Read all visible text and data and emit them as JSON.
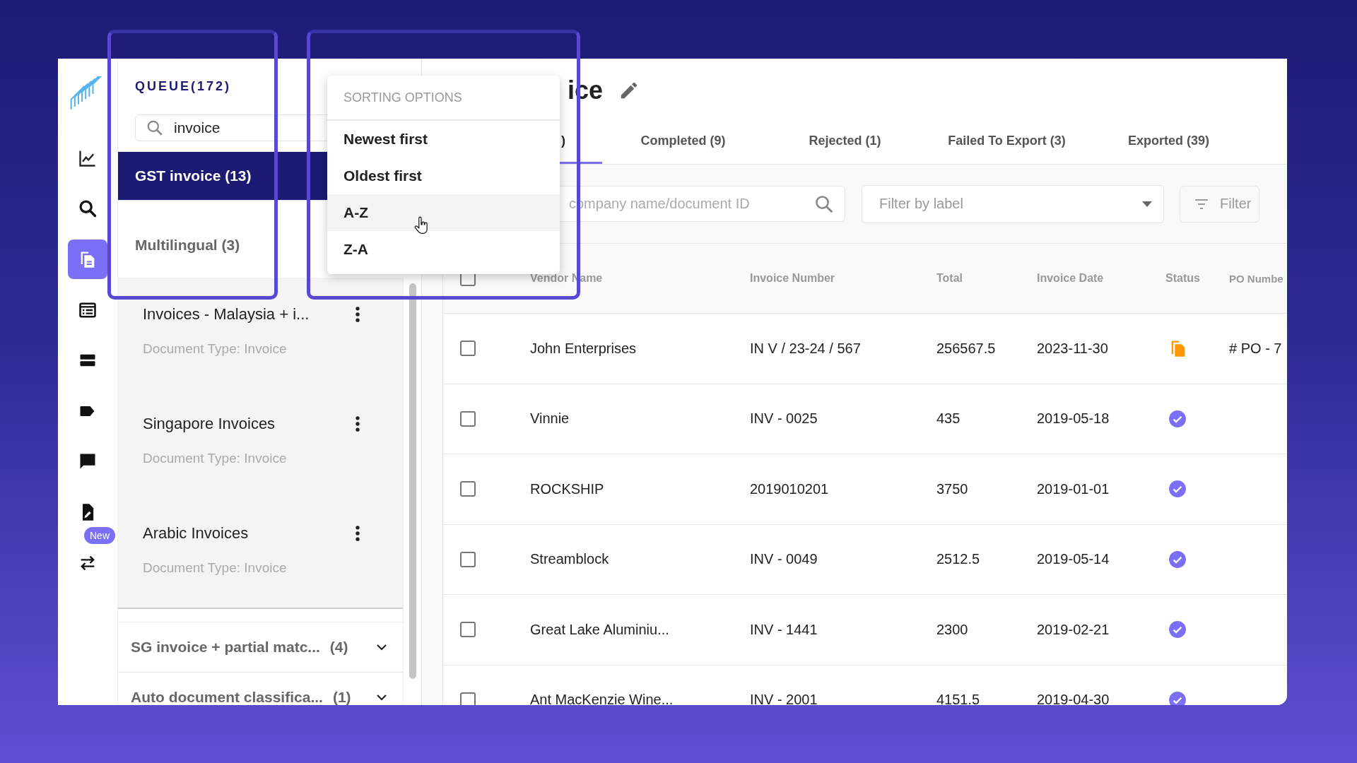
{
  "rail": {
    "items": [
      {
        "selected": false
      },
      {
        "selected": false
      },
      {
        "selected": true
      },
      {
        "selected": false
      },
      {
        "selected": false
      },
      {
        "selected": false
      },
      {
        "selected": false
      },
      {
        "selected": false
      },
      {
        "selected": false,
        "badge": "New"
      }
    ]
  },
  "queue": {
    "title": "QUEUE(172)",
    "search": {
      "value": "invoice"
    },
    "items": [
      {
        "label": "GST invoice (13)",
        "selected": true
      },
      {
        "label": "Multilingual (3)",
        "selected": false
      }
    ],
    "subqueues": [
      {
        "name": "Invoices - Malaysia + i...",
        "document_type": "Document Type: Invoice"
      },
      {
        "name": "Singapore Invoices",
        "document_type": "Document Type: Invoice"
      },
      {
        "name": "Arabic Invoices",
        "document_type": "Document Type: Invoice"
      }
    ],
    "groups": [
      {
        "name": "SG invoice + partial matc...",
        "count": "(4)"
      },
      {
        "name": "Auto document classifica...",
        "count": "(1)"
      }
    ]
  },
  "sort_menu": {
    "title": "SORTING OPTIONS",
    "options": [
      {
        "label": "Newest first",
        "hovered": false
      },
      {
        "label": "Oldest first",
        "hovered": false
      },
      {
        "label": "A-Z",
        "hovered": true
      },
      {
        "label": "Z-A",
        "hovered": false
      }
    ]
  },
  "header": {
    "title": "ice"
  },
  "tabs": [
    {
      "label": ")",
      "selected": true
    },
    {
      "label": "Completed (9)",
      "selected": false
    },
    {
      "label": "Rejected (1)",
      "selected": false
    },
    {
      "label": "Failed To Export (3)",
      "selected": false
    },
    {
      "label": "Exported (39)",
      "selected": false
    }
  ],
  "toolbar": {
    "search": {
      "placeholder": "company name/document ID"
    },
    "label_filter": {
      "placeholder": "Filter by label"
    },
    "filter_button": "Filter"
  },
  "table": {
    "select_all_checked": false,
    "columns": [
      "Vendor Name",
      "Invoice Number",
      "Total",
      "Invoice Date",
      "Status",
      "PO Numbe"
    ],
    "rows": [
      {
        "checked": false,
        "vendor": "John Enterprises",
        "invoice_number": "IN V / 23-24 / 567",
        "total": "256567.5",
        "date": "2023-11-30",
        "status": {
          "kind": "duplicate"
        },
        "po_number": "# PO - 7"
      },
      {
        "checked": false,
        "vendor": "Vinnie",
        "invoice_number": "INV - 0025",
        "total": "435",
        "date": "2019-05-18",
        "status": {
          "kind": "approved"
        }
      },
      {
        "checked": false,
        "vendor": "ROCKSHIP",
        "invoice_number": "2019010201",
        "total": "3750",
        "date": "2019-01-01",
        "status": {
          "kind": "approved"
        }
      },
      {
        "checked": false,
        "vendor": "Streamblock",
        "invoice_number": "INV - 0049",
        "total": "2512.5",
        "date": "2019-05-14",
        "status": {
          "kind": "approved"
        }
      },
      {
        "checked": false,
        "vendor": "Great Lake Aluminiu...",
        "invoice_number": "INV - 1441",
        "total": "2300",
        "date": "2019-02-21",
        "status": {
          "kind": "approved"
        }
      },
      {
        "checked": false,
        "vendor": "Ant MacKenzie Wine...",
        "invoice_number": "INV - 2001",
        "total": "4151.5",
        "date": "2019-04-30",
        "status": {
          "kind": "approved"
        }
      }
    ]
  }
}
